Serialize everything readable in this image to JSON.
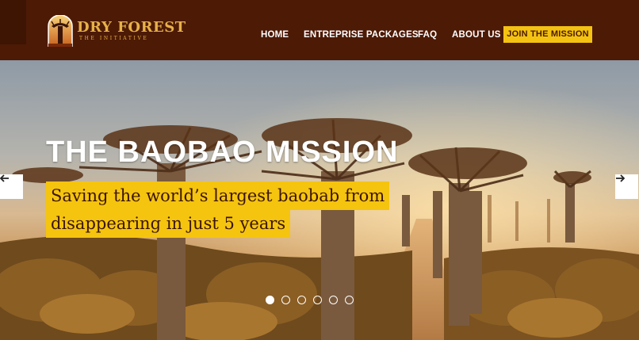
{
  "logo": {
    "title": "DRY FOREST",
    "subtitle": "THE INITIATIVE",
    "icon": "baobab-logo-icon"
  },
  "nav": {
    "items": [
      "HOME",
      "ENTREPRISE PACKAGES",
      "FAQ",
      "ABOUT US"
    ],
    "cta": "JOIN THE MISSION"
  },
  "hero": {
    "title": "THE BAOBAO MISSION",
    "subtitle_line1": "Saving the world’s largest baobab from",
    "subtitle_line2": "disappearing in just 5 years",
    "prev_icon": "arrow-left-icon",
    "next_icon": "arrow-right-icon",
    "slide_count": 6,
    "active_slide": 1
  },
  "colors": {
    "header_bg": "#4d1a05",
    "accent_yellow": "#f4c312",
    "logo_gold": "#e6b04a"
  }
}
